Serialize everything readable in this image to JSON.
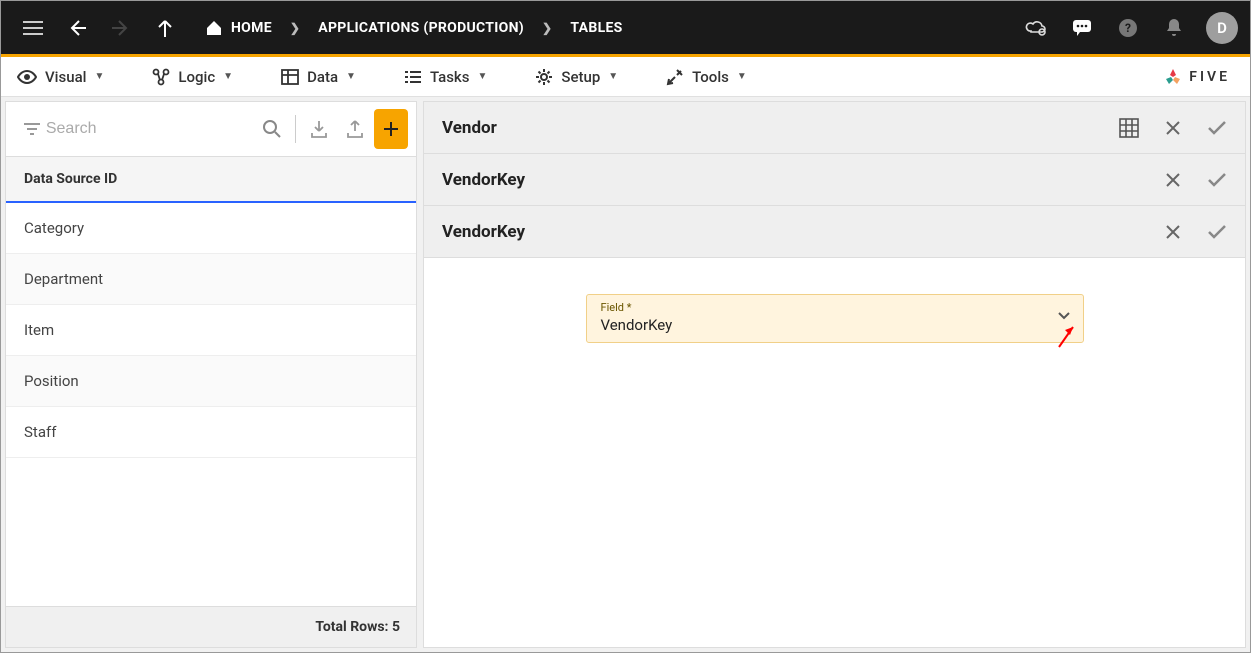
{
  "topbar": {
    "breadcrumbs": [
      {
        "label": "HOME"
      },
      {
        "label": "APPLICATIONS (PRODUCTION)"
      },
      {
        "label": "TABLES"
      }
    ],
    "avatar_initial": "D"
  },
  "menubar": {
    "items": [
      {
        "label": "Visual"
      },
      {
        "label": "Logic"
      },
      {
        "label": "Data"
      },
      {
        "label": "Tasks"
      },
      {
        "label": "Setup"
      },
      {
        "label": "Tools"
      }
    ],
    "brand": "FIVE"
  },
  "sidebar": {
    "search_placeholder": "Search",
    "header": "Data Source ID",
    "items": [
      {
        "label": "Category"
      },
      {
        "label": "Department"
      },
      {
        "label": "Item"
      },
      {
        "label": "Position"
      },
      {
        "label": "Staff"
      }
    ],
    "footer": "Total Rows: 5"
  },
  "main": {
    "sections": [
      {
        "title": "Vendor",
        "has_grid": true
      },
      {
        "title": "VendorKey",
        "has_grid": false
      },
      {
        "title": "VendorKey",
        "has_grid": false
      }
    ],
    "field": {
      "label": "Field *",
      "value": "VendorKey"
    }
  }
}
